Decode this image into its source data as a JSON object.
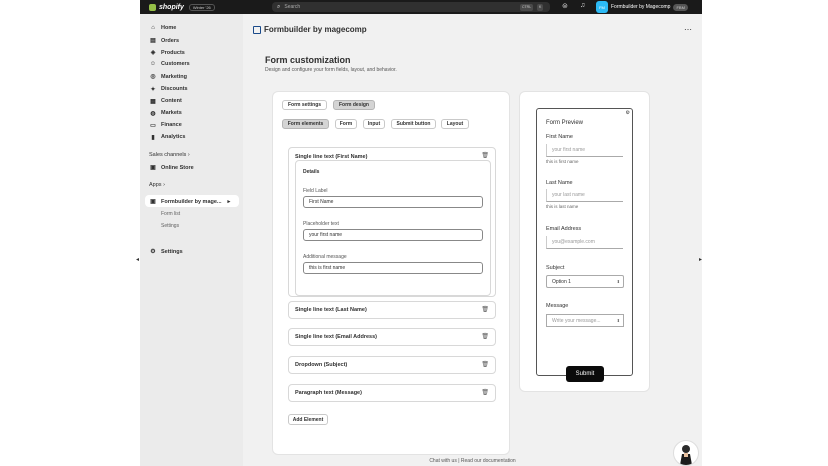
{
  "topbar": {
    "brand": "shopify",
    "edition": "Winter '26",
    "search_placeholder": "Search",
    "kbd1": "CTRL",
    "kbd2": "K",
    "store_avatar": "FM",
    "store_name": "Formbuilder by Magecomp",
    "store_chip": "FBM"
  },
  "sidebar": {
    "items": [
      {
        "label": "Home",
        "icon": "home-icon",
        "glyph": "⌂"
      },
      {
        "label": "Orders",
        "icon": "orders-icon",
        "glyph": "▤"
      },
      {
        "label": "Products",
        "icon": "products-icon",
        "glyph": "◈"
      },
      {
        "label": "Customers",
        "icon": "customers-icon",
        "glyph": "☺"
      },
      {
        "label": "Marketing",
        "icon": "marketing-icon",
        "glyph": "◎"
      },
      {
        "label": "Discounts",
        "icon": "discounts-icon",
        "glyph": "✦"
      },
      {
        "label": "Content",
        "icon": "content-icon",
        "glyph": "▦"
      },
      {
        "label": "Markets",
        "icon": "markets-icon",
        "glyph": "◍"
      },
      {
        "label": "Finance",
        "icon": "finance-icon",
        "glyph": "▭"
      },
      {
        "label": "Analytics",
        "icon": "analytics-icon",
        "glyph": "▮"
      }
    ],
    "sales_channels_label": "Sales channels ›",
    "online_store": "Online Store",
    "apps_label": "Apps ›",
    "app_name": "Formbuilder by mage...",
    "app_sub1": "Form list",
    "app_sub2": "Settings",
    "settings": "Settings"
  },
  "main": {
    "app_title": "Formbuilder by magecomp",
    "page_title": "Form customization",
    "page_subtitle": "Design and configure your form fields, layout, and behavior.",
    "tabs": [
      "Form settings",
      "Form design"
    ],
    "subtabs": [
      "Form elements",
      "Form",
      "Input",
      "Submit button",
      "Layout"
    ],
    "first_element": {
      "title": "Single line text (First Name)",
      "details": "Details",
      "field_label_label": "Field Label",
      "field_label_value": "First Name",
      "placeholder_label": "Placeholder text",
      "placeholder_value": "your first name",
      "additional_label": "Additional message",
      "additional_value": "this is first name"
    },
    "elements": [
      "Single line text (Last Name)",
      "Single line text (Email Address)",
      "Dropdown (Subject)",
      "Paragraph text (Message)"
    ],
    "add_element": "Add Element",
    "footer": "Chat with us | Read our documentation"
  },
  "preview": {
    "title": "Form Preview",
    "first_name_label": "First Name",
    "first_name_placeholder": "your first name",
    "first_name_hint": "this is first name",
    "last_name_label": "Last Name",
    "last_name_placeholder": "your last name",
    "last_name_hint": "this is last name",
    "email_label": "Email Address",
    "email_placeholder": "you@example.com",
    "subject_label": "Subject",
    "subject_value": "Option 1",
    "message_label": "Message",
    "message_placeholder": "Write your message...",
    "submit": "Submit"
  }
}
